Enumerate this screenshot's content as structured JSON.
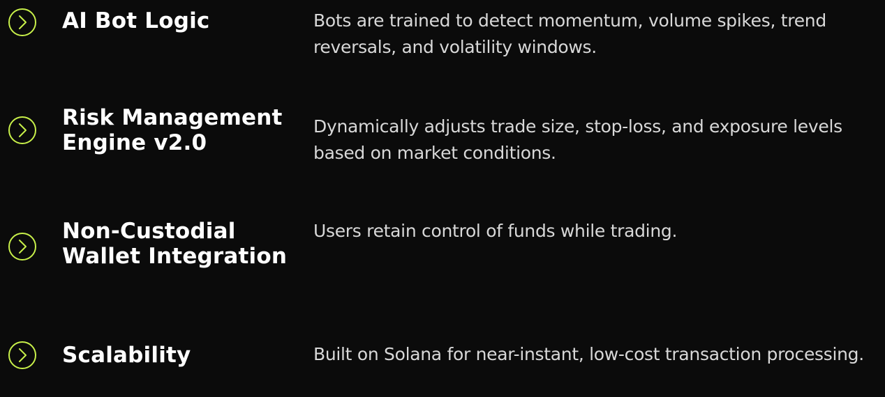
{
  "theme": {
    "background": "#0b0b0b",
    "accent": "#c8f04a",
    "title_color": "#ffffff",
    "text_color": "#d8d8d8"
  },
  "features": [
    {
      "icon": "chevron-right-circle-icon",
      "title": "AI Bot Logic",
      "description": "Bots are trained to detect momentum, volume spikes, trend reversals, and volatility windows."
    },
    {
      "icon": "chevron-right-circle-icon",
      "title": "Risk Management Engine v2.0",
      "description": "Dynamically adjusts trade size, stop-loss, and exposure levels based on market conditions."
    },
    {
      "icon": "chevron-right-circle-icon",
      "title": "Non-Custodial Wallet Integration",
      "description": "Users retain control of funds while trading."
    },
    {
      "icon": "chevron-right-circle-icon",
      "title": "Scalability",
      "description": "Built on Solana for near-instant, low-cost transaction processing."
    }
  ]
}
